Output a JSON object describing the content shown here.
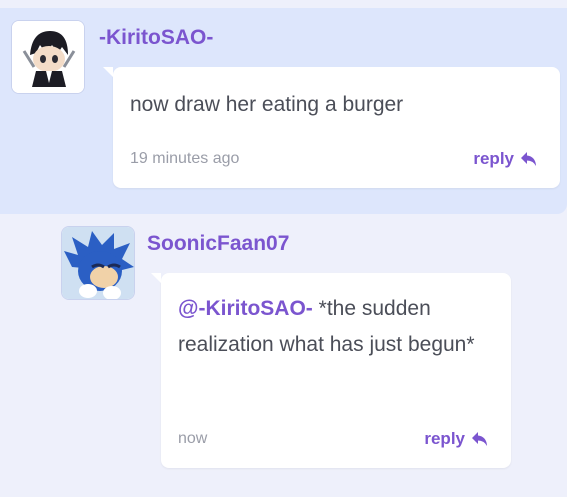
{
  "comments": [
    {
      "username": "-KiritoSAO-",
      "avatar_icon": "chibi-character-avatar",
      "text": "now draw her eating a burger",
      "time": "19 minutes ago",
      "reply_label": "reply"
    },
    {
      "username": "SoonicFaan07",
      "avatar_icon": "blue-hedgehog-avatar",
      "mention": "@-KiritoSAO-",
      "text": " *the sudden realization what has just begun*",
      "time": "now",
      "reply_label": "reply"
    }
  ],
  "colors": {
    "accent": "#7b55cf",
    "thread_bg": "#dde6fc",
    "page_bg": "#eef0fb"
  }
}
